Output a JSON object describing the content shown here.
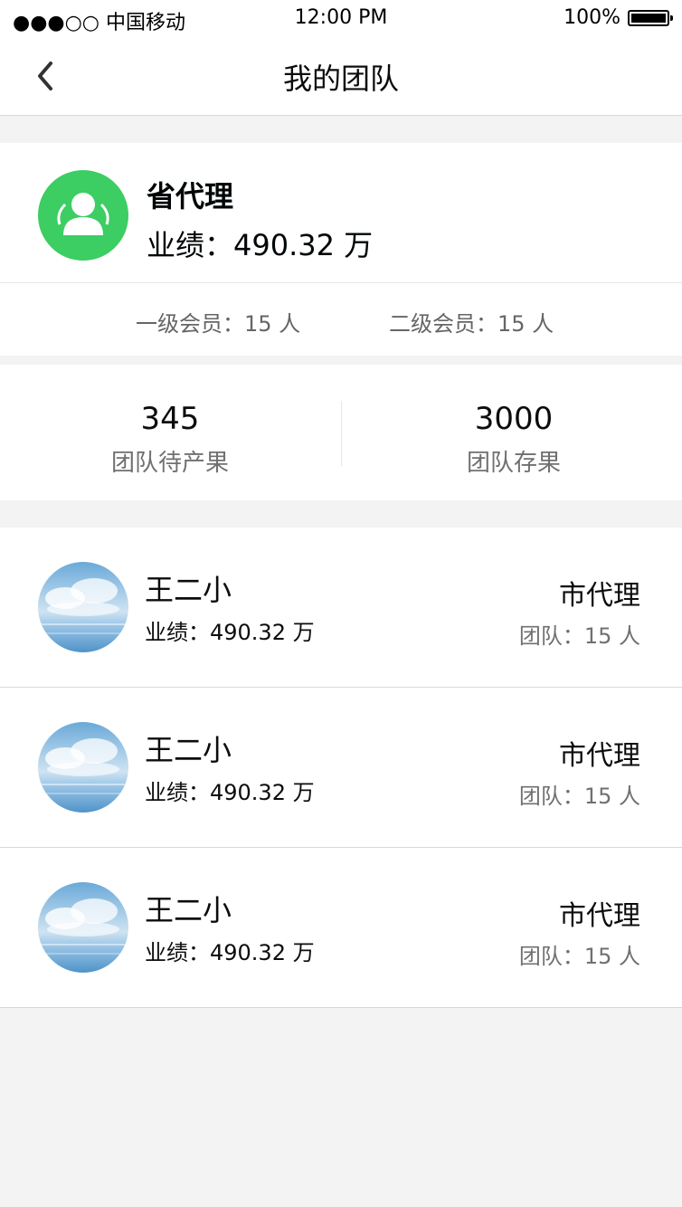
{
  "status_bar": {
    "carrier": "●●●○○ 中国移动",
    "time": "12:00 PM",
    "battery": "100%"
  },
  "nav": {
    "title": "我的团队",
    "back_icon": "chevron-left-icon"
  },
  "summary": {
    "avatar_icon": "user-icon",
    "avatar_color": "#3ccd63",
    "rank": "省代理",
    "performance": "业绩：490.32 万",
    "level1_members": "一级会员：15 人",
    "level2_members": "二级会员：15 人"
  },
  "stats": {
    "pending_value": "345",
    "pending_label": "团队待产果",
    "stock_value": "3000",
    "stock_label": "团队存果"
  },
  "members": [
    {
      "name": "王二小",
      "performance": "业绩：490.32 万",
      "level": "市代理",
      "team": "团队：15 人"
    },
    {
      "name": "王二小",
      "performance": "业绩：490.32 万",
      "level": "市代理",
      "team": "团队：15 人"
    },
    {
      "name": "王二小",
      "performance": "业绩：490.32 万",
      "level": "市代理",
      "team": "团队：15 人"
    }
  ],
  "colors": {
    "primary_text": "#000607",
    "secondary_text": "#666666",
    "stat_number": "#0c0c0c",
    "stat_label": "#707070"
  }
}
